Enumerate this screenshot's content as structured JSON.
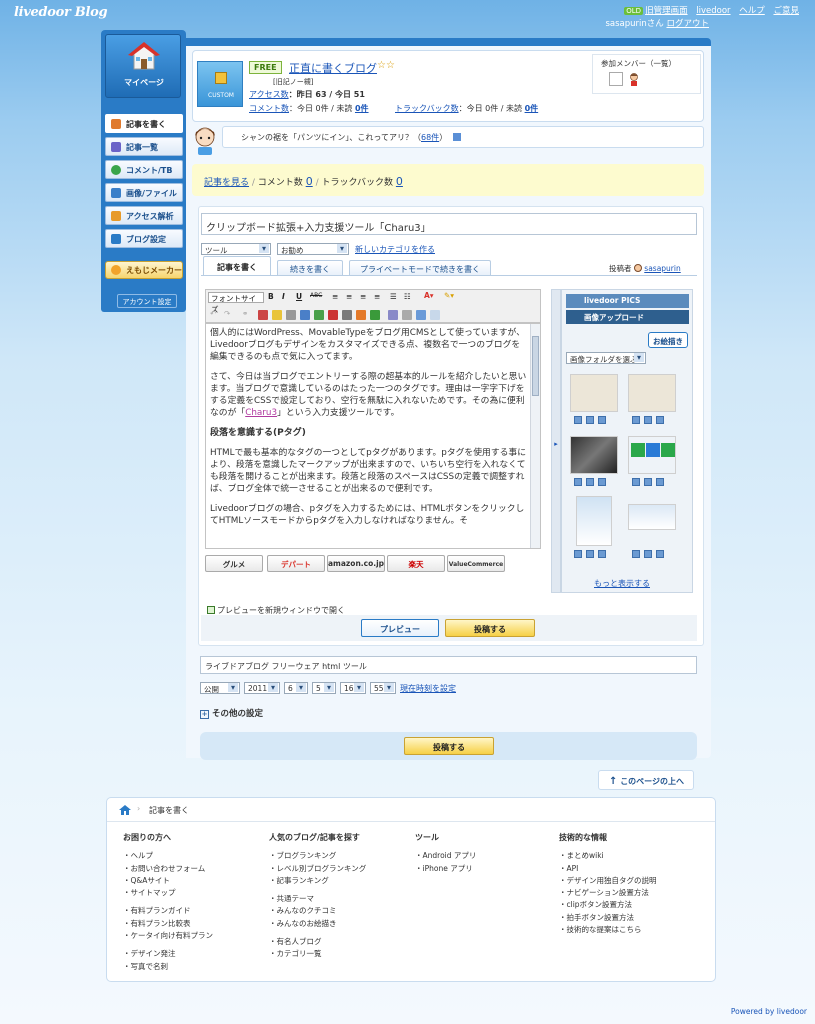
{
  "header": {
    "logo": "livedoor Blog",
    "old_badge": "OLD",
    "links": [
      "旧管理画面",
      "livedoor",
      "ヘルプ",
      "ご意見"
    ],
    "user_name_suffix": "sasapurinさん",
    "logout": "ログアウト"
  },
  "sidebar": {
    "mypage_label": "マイページ",
    "items": [
      {
        "label": "記事を書く",
        "active": true,
        "color": "#e07a2d"
      },
      {
        "label": "記事一覧",
        "active": false,
        "color": "#6a63c8"
      },
      {
        "label": "コメント/TB",
        "active": false,
        "color": "#3aa54a"
      },
      {
        "label": "画像/ファイル",
        "active": false,
        "color": "#3a7fc9"
      },
      {
        "label": "アクセス解析",
        "active": false,
        "color": "#e79a2a"
      },
      {
        "label": "ブログ設定",
        "active": false,
        "color": "#2a7bc6"
      }
    ],
    "emoji_maker": "えもじメーカー",
    "account": "アカウント設定"
  },
  "blog": {
    "custom_label": "CUSTOM",
    "free_badge": "FREE",
    "title": "正直に書くブログ",
    "stars": "☆☆",
    "sub_link": "[旧記ノー槻]",
    "access_label": "アクセス数",
    "access_value": "：昨日 63 / 今日 51",
    "comment_label": "コメント数",
    "comment_value": "：今日 0件 / 未読",
    "comment_unread": "0件",
    "tb_label": "トラックバック数",
    "tb_value": "：今日 0件 / 未読",
    "tb_unread": "0件",
    "members_title": "参加メンバー（一覧）"
  },
  "speech": {
    "text": "シャンの裾を「パンツにイン」、これってアリ？（",
    "count_link": "68件",
    "close": "）"
  },
  "summary": {
    "view_article": "記事を見る",
    "comments_label": "コメント数",
    "comments_count": "0",
    "tb_label": "トラックバック数",
    "tb_count": "0"
  },
  "editor": {
    "title_value": "クリップボード拡張+入力支援ツール「Charu3」",
    "category_select": "ツール",
    "recommend_select": "お勧め",
    "new_category": "新しいカテゴリを作る",
    "tabs": [
      "記事を書く",
      "続きを書く",
      "プライベートモードで続きを書く"
    ],
    "poster_label": "投稿者",
    "poster_name": "sasapurin",
    "font_size": "フォントサイズ",
    "body": [
      {
        "type": "p",
        "text": "個人的にはWordPress、MovableTypeをブログ用CMSとして使っていますが、Livedoorブログもデザインをカスタマイズできる点、複数名で一つのブログを編集できるのも点で気に入ってます。"
      },
      {
        "type": "p",
        "text": "さて、今日は当ブログでエントリーする際の超基本的ルールを紹介したいと思います。当ブログで意識しているのはたった一つのタグです。理由は一字字下げをする定義をCSSで設定しており、空行を無駄に入れないためです。その為に便利なのが「"
      },
      {
        "type": "h",
        "text": "段落を意識する(Pタグ)"
      },
      {
        "type": "p",
        "text": "HTMLで最も基本的なタグの一つとしてpタグがあります。pタグを使用する事により、段落を意識したマークアップが出来ますので、いちいち空行を入れなくても段落を開けることが出来ます。段落と段落のスペースはCSSの定義で調整すれば、ブログ全体で統一させることが出来るので便利です。"
      },
      {
        "type": "p",
        "text": "Livedoorブログの場合、pタグを入力するためには、HTMLボタンをクリックしてHTMLソースモードからpタグを入力しなければなりません。そ"
      }
    ],
    "charu3_link": "Charu3",
    "charu3_tail": "」という入力支援ツールです。",
    "shops": [
      "グルメ",
      "デパート",
      "amazon.co.jp",
      "楽天",
      "ValueCommerce"
    ],
    "preview_check": "プレビューを新規ウィンドウで開く",
    "preview_btn": "プレビュー",
    "post_btn": "投稿する"
  },
  "side_panel": {
    "pics": "livedoor PICS",
    "upload": "画像アップロード",
    "oekaki": "お絵描き",
    "folder_select": "画像フォルダを選ぶ",
    "more": "もっと表示する"
  },
  "meta": {
    "tags": "ライブドアブログ フリーウェア html ツール",
    "status": "公開",
    "year": "2011",
    "month": "6",
    "day": "5",
    "hour": "16",
    "minute": "55",
    "now_link": "現在時刻を設定",
    "other_settings": "その他の設定",
    "post_btn": "投稿する"
  },
  "page_top": "このページの上へ",
  "footer": {
    "breadcrumb": "記事を書く",
    "cols": [
      {
        "title": "お困りの方へ",
        "groups": [
          [
            "ヘルプ",
            "お問い合わせフォーム",
            "Q&Aサイト",
            "サイトマップ"
          ],
          [
            "有料プランガイド",
            "有料プラン比較表",
            "ケータイ向け有料プラン"
          ],
          [
            "デザイン発注",
            "写真で名刺"
          ]
        ]
      },
      {
        "title": "人気のブログ/記事を探す",
        "groups": [
          [
            "ブログランキング",
            "レベル別ブログランキング",
            "記事ランキング"
          ],
          [
            "共通テーマ",
            "みんなのクチコミ",
            "みんなのお絵描き"
          ],
          [
            "有名人ブログ",
            "カテゴリ一覧"
          ]
        ]
      },
      {
        "title": "ツール",
        "groups": [
          [
            "Android アプリ",
            "iPhone アプリ"
          ]
        ]
      },
      {
        "title": "技術的な情報",
        "groups": [
          [
            "まとめwiki",
            "API",
            "デザイン用独自タグの説明",
            "ナビゲーション設置方法",
            "clipボタン設置方法",
            "拍手ボタン設置方法",
            "技術的な提案はこちら"
          ]
        ]
      }
    ]
  },
  "powered": "Powered by livedoor"
}
